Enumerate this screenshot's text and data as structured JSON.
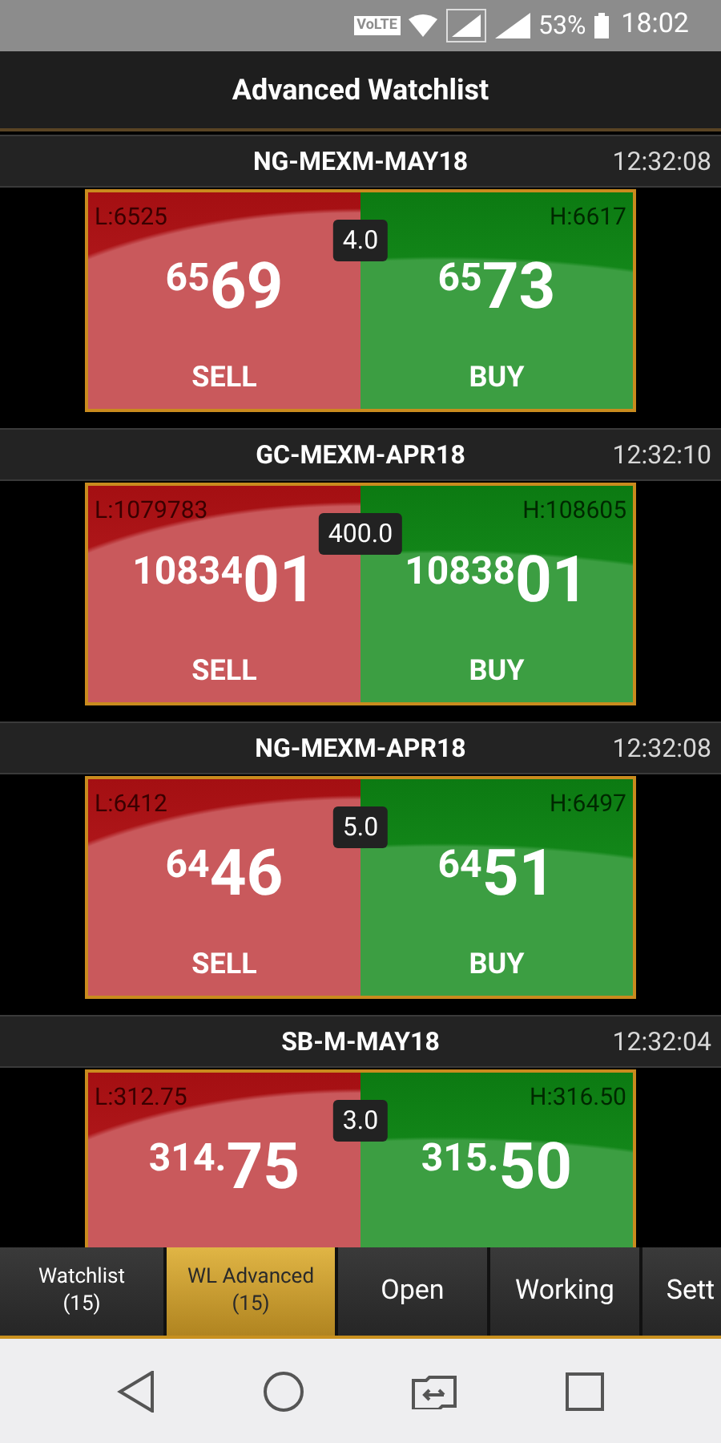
{
  "status_bar": {
    "volte": "VoLTE",
    "battery": "53%",
    "time": "18:02"
  },
  "title": "Advanced Watchlist",
  "cards": [
    {
      "symbol": "NG-MEXM-MAY18",
      "time": "12:32:08",
      "low": "L:6525",
      "high": "H:6617",
      "spread": "4.0",
      "sell": {
        "small": "65",
        "big": "69",
        "label": "SELL"
      },
      "buy": {
        "small": "65",
        "big": "73",
        "label": "BUY"
      }
    },
    {
      "symbol": "GC-MEXM-APR18",
      "time": "12:32:10",
      "low": "L:1079783",
      "high": "H:108605",
      "spread": "400.0",
      "sell": {
        "small": "10834",
        "big": "01",
        "label": "SELL"
      },
      "buy": {
        "small": "10838",
        "big": "01",
        "label": "BUY"
      }
    },
    {
      "symbol": "NG-MEXM-APR18",
      "time": "12:32:08",
      "low": "L:6412",
      "high": "H:6497",
      "spread": "5.0",
      "sell": {
        "small": "64",
        "big": "46",
        "label": "SELL"
      },
      "buy": {
        "small": "64",
        "big": "51",
        "label": "BUY"
      }
    },
    {
      "symbol": "SB-M-MAY18",
      "time": "12:32:04",
      "low": "L:312.75",
      "high": "H:316.50",
      "spread": "3.0",
      "sell": {
        "small": "314.",
        "big": "75"
      },
      "buy": {
        "small": "315.",
        "big": "50"
      }
    }
  ],
  "tabs": [
    {
      "label": "Watchlist",
      "count": "(15)",
      "selected": false
    },
    {
      "label": "WL Advanced",
      "count": "(15)",
      "selected": true
    },
    {
      "label": "Open",
      "selected": false
    },
    {
      "label": "Working",
      "selected": false
    },
    {
      "label": "Sett",
      "selected": false
    }
  ]
}
